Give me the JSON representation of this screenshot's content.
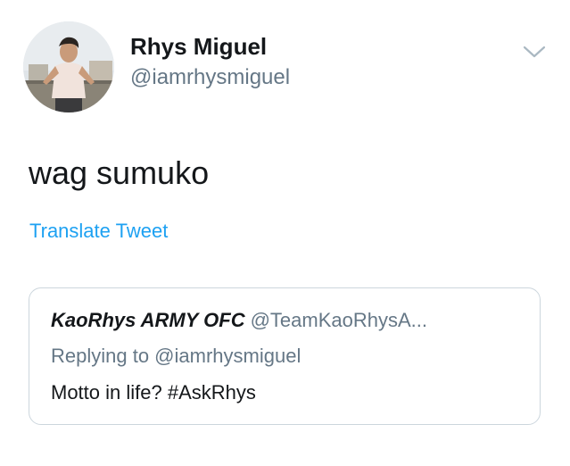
{
  "tweet": {
    "author": {
      "display_name": "Rhys Miguel",
      "handle": "@iamrhysmiguel"
    },
    "text": "wag sumuko",
    "translate_label": "Translate Tweet",
    "menu_icon": "chevron-down-icon"
  },
  "quoted_tweet": {
    "author_name": "KaoRhys ARMY OFC",
    "author_handle": "@TeamKaoRhysA...",
    "reply_context": "Replying to @iamrhysmiguel",
    "text": "Motto in life? #AskRhys"
  },
  "colors": {
    "link": "#1da1f2",
    "secondary_text": "#657786",
    "border": "#ccd6dd"
  }
}
